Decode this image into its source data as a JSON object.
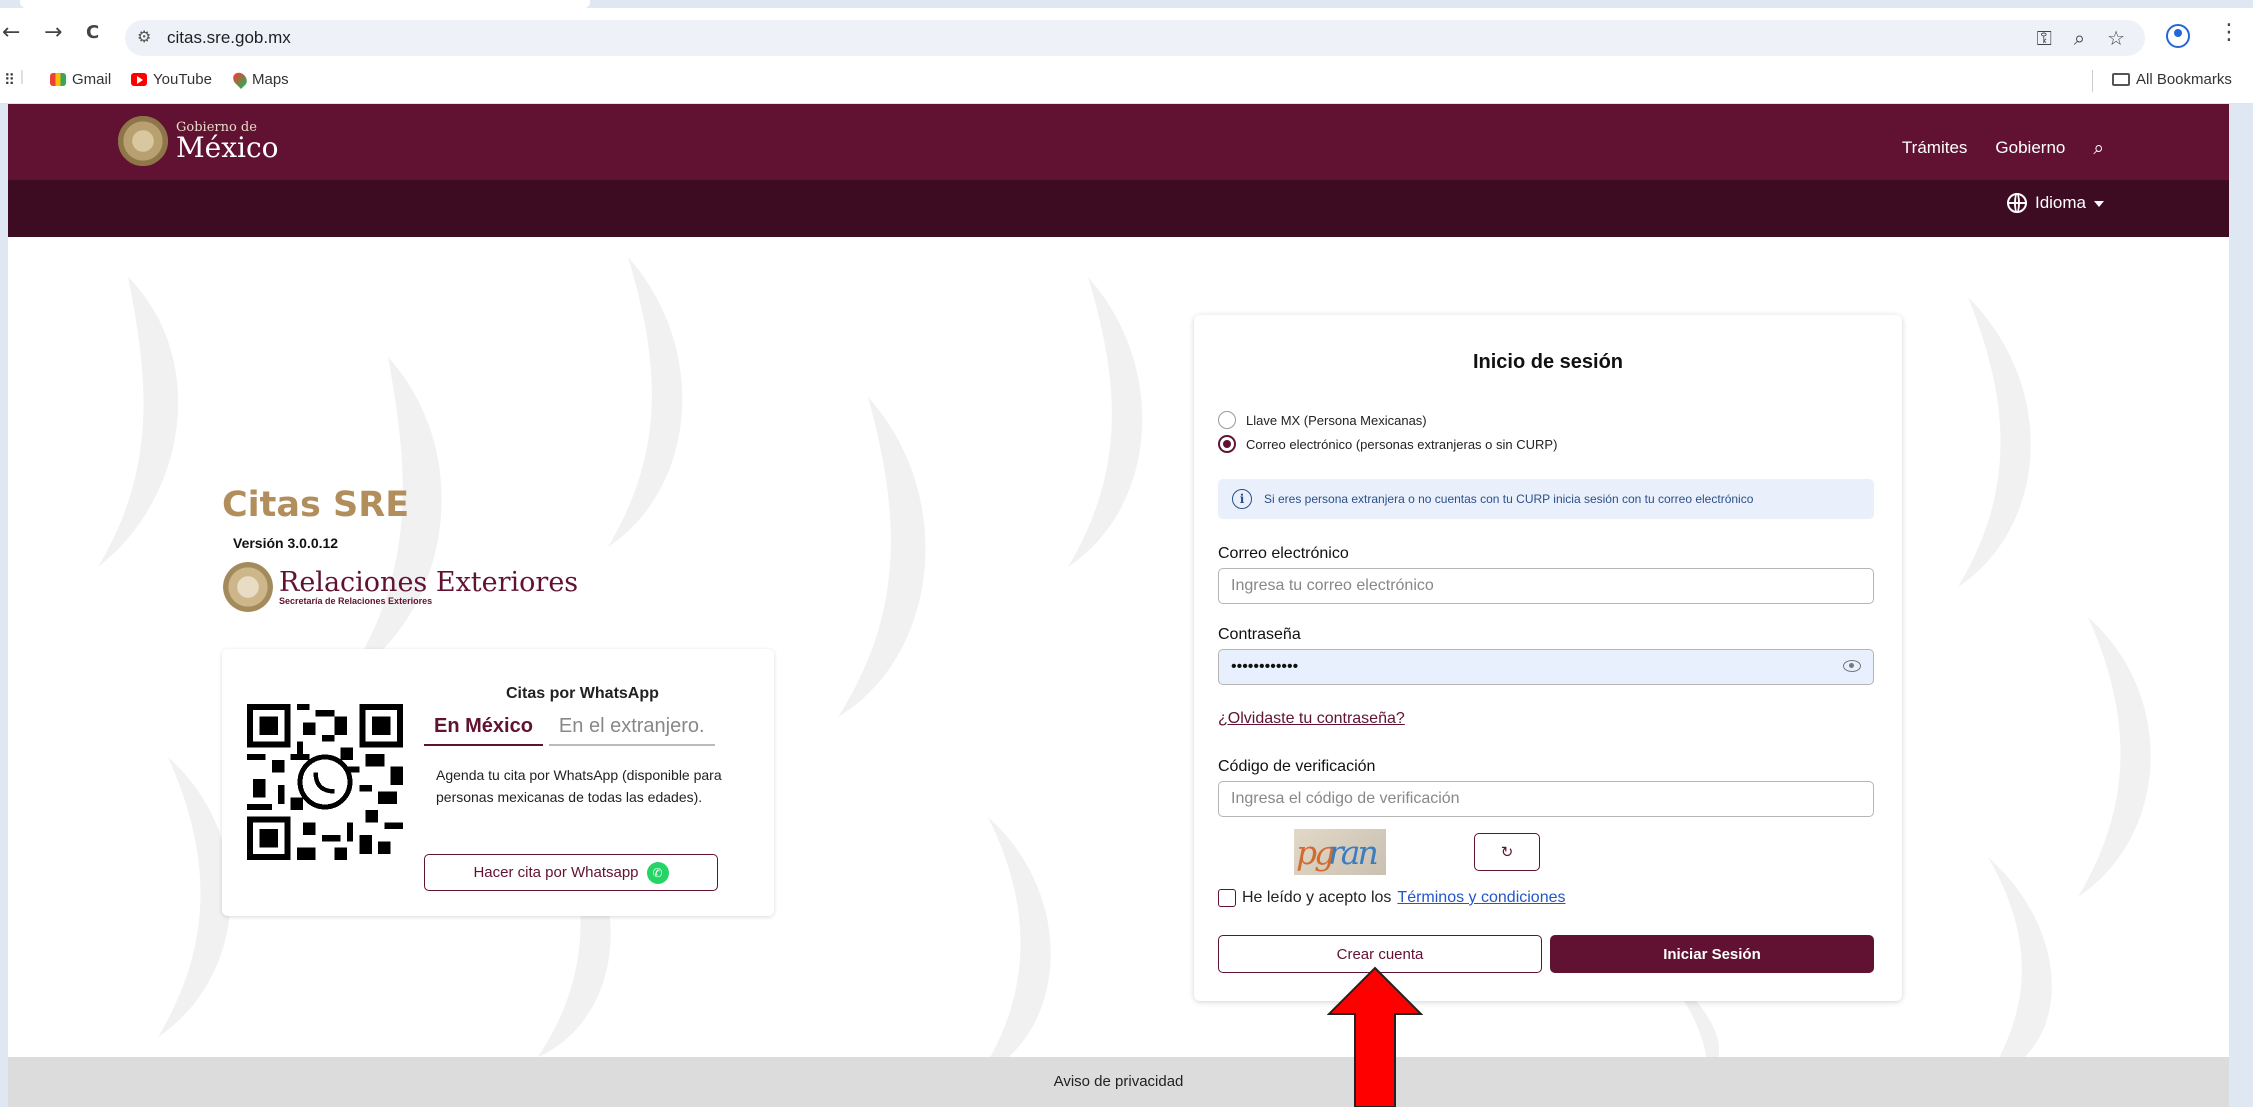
{
  "browser": {
    "url": "citas.sre.gob.mx",
    "bookmarks": [
      "Gmail",
      "YouTube",
      "Maps"
    ],
    "all_bookmarks": "All Bookmarks",
    "nav_back": "←",
    "nav_forward": "→",
    "nav_reload": "C",
    "omni_icons": [
      "key-icon",
      "zoom-icon",
      "star-icon"
    ]
  },
  "header": {
    "logo_small": "Gobierno de",
    "logo_big": "México",
    "nav": [
      "Trámites",
      "Gobierno"
    ],
    "idioma": "Idioma"
  },
  "brand": {
    "title": "Citas SRE",
    "version": "Versión 3.0.0.12",
    "sre_big": "Relaciones Exteriores",
    "sre_small": "Secretaría de Relaciones Exteriores"
  },
  "whatsapp": {
    "title": "Citas por WhatsApp",
    "tabs": [
      "En México",
      "En el extranjero."
    ],
    "description": "Agenda tu cita por WhatsApp (disponible para personas mexicanas de todas las edades).",
    "button": "Hacer cita por Whatsapp"
  },
  "login": {
    "title": "Inicio de sesión",
    "radio_llave": "Llave MX (Persona Mexicanas)",
    "radio_correo": "Correo electrónico (personas extranjeras o sin CURP)",
    "info": "Si eres persona extranjera o no cuentas con tu CURP inicia sesión con tu correo electrónico",
    "email_label": "Correo electrónico",
    "email_placeholder": "Ingresa tu correo electrónico",
    "password_label": "Contraseña",
    "password_value": "••••••••••••",
    "forgot": "¿Olvidaste tu contraseña?",
    "code_label": "Código de verificación",
    "code_placeholder": "Ingresa el código de verificación",
    "captcha_a": "pg",
    "captcha_b": "ran",
    "refresh": "↻",
    "terms_prefix": "He leído y acepto los",
    "terms_link": "Términos y condiciones",
    "create_account": "Crear cuenta",
    "sign_in": "Iniciar Sesión"
  },
  "footer": {
    "privacy": "Aviso de privacidad"
  },
  "colors": {
    "brand_primary": "#611232",
    "brand_dark": "#3e0c22",
    "brand_gold": "#b38e5d",
    "annotation_arrow": "#ff0000"
  }
}
